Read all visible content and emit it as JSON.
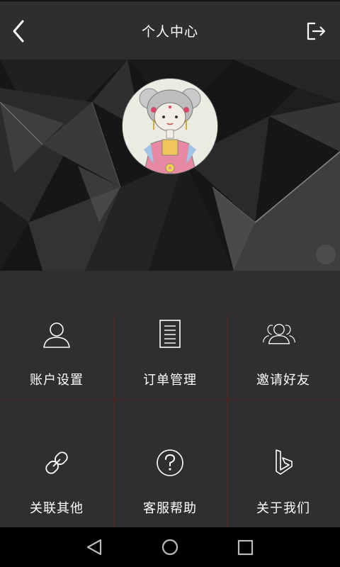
{
  "header": {
    "title": "个人中心",
    "back_icon": "chevron-left-icon",
    "logout_icon": "logout-icon"
  },
  "profile": {
    "avatar": "avatar-illustration"
  },
  "menu": [
    {
      "label": "账户设置",
      "icon": "user-icon"
    },
    {
      "label": "订单管理",
      "icon": "document-list-icon"
    },
    {
      "label": "邀请好友",
      "icon": "users-icon"
    },
    {
      "label": "关联其他",
      "icon": "link-icon"
    },
    {
      "label": "客服帮助",
      "icon": "help-circle-icon"
    },
    {
      "label": "关于我们",
      "icon": "bing-logo-icon"
    }
  ],
  "navbar": {
    "back": "triangle-back-icon",
    "home": "circle-home-icon",
    "recents": "square-recents-icon"
  },
  "colors": {
    "header_bg": "#2e2e2e",
    "tile_bg": "#2f2f2f",
    "divider": "#5a2424"
  }
}
